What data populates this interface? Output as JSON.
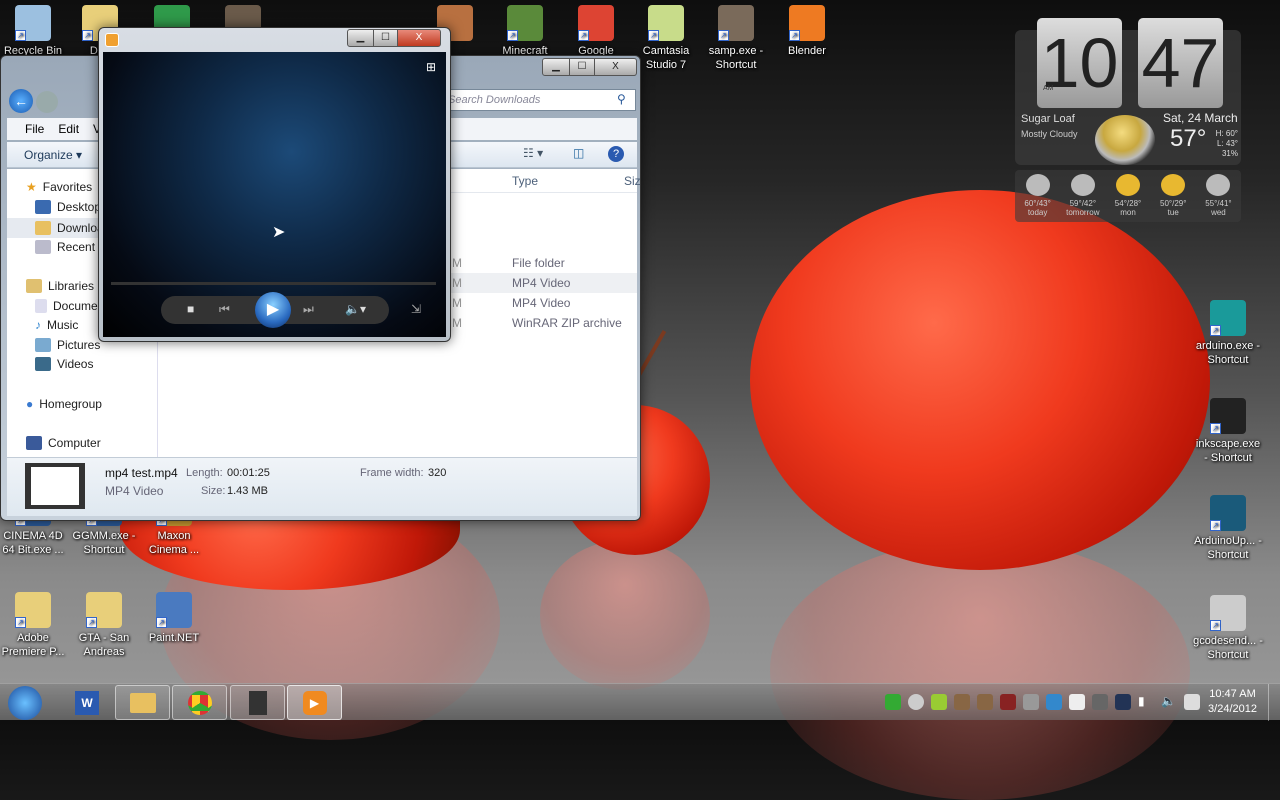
{
  "desktop_icons_top": [
    {
      "label": "Recycle Bin",
      "color": "#9cc0e0"
    },
    {
      "label": "Dr...",
      "color": "#e8cf7a"
    },
    {
      "label": "",
      "color": "#2f9a4a"
    },
    {
      "label": "",
      "color": "#6a5a4a"
    },
    {
      "label": "",
      "color": "#b87040"
    },
    {
      "label": "Minecraft",
      "color": "#5a8a3a"
    },
    {
      "label": "Google Chrome",
      "color": "#dd4433"
    },
    {
      "label": "Camtasia Studio 7",
      "color": "#c8dc8a"
    },
    {
      "label": "samp.exe - Shortcut",
      "color": "#7a6a5a"
    },
    {
      "label": "Blender",
      "color": "#ee7a22"
    }
  ],
  "desktop_icons_left": [
    {
      "label": "CINEMA 4D 64 Bit.exe ...",
      "color": "#2a5a9a"
    },
    {
      "label": "GGMM.exe - Shortcut",
      "color": "#2a5a9a"
    },
    {
      "label": "Maxon Cinema ...",
      "color": "#c89a30"
    },
    {
      "label": "Adobe Premiere P...",
      "color": "#e8cf7a"
    },
    {
      "label": "GTA - San Andreas",
      "color": "#e8cf7a"
    },
    {
      "label": "Paint.NET",
      "color": "#4a7ac0"
    }
  ],
  "desktop_icons_right": [
    {
      "label": "arduino.exe - Shortcut",
      "color": "#1a9a9a"
    },
    {
      "label": "inkscape.exe - Shortcut",
      "color": "#222222"
    },
    {
      "label": "ArduinoUp... - Shortcut",
      "color": "#1a5a7a"
    },
    {
      "label": "gcodesend... - Shortcut",
      "color": "#cccccc"
    }
  ],
  "widget": {
    "hour": "10",
    "minute": "47",
    "ampm": "AM",
    "location": "Sugar Loaf",
    "condition": "Mostly Cloudy",
    "date": "Sat, 24 March",
    "temp": "57°",
    "high": "H: 60°",
    "low": "L: 43°",
    "humidity": "31%",
    "forecast": [
      {
        "temps": "60°/43°",
        "day": "today"
      },
      {
        "temps": "59°/42°",
        "day": "tomorrow"
      },
      {
        "temps": "54°/28°",
        "day": "mon"
      },
      {
        "temps": "50°/29°",
        "day": "tue"
      },
      {
        "temps": "55°/41°",
        "day": "wed"
      }
    ]
  },
  "explorer": {
    "search_placeholder": "Search Downloads",
    "menu": [
      "File",
      "Edit",
      "V"
    ],
    "organize": "Organize ▾",
    "nav": {
      "favorites": "Favorites",
      "desktop": "Desktop",
      "downloads": "Downloads",
      "recent": "Recent Places",
      "libraries": "Libraries",
      "documents": "Documents",
      "music": "Music",
      "pictures": "Pictures",
      "videos": "Videos",
      "homegroup": "Homegroup",
      "computer": "Computer"
    },
    "columns": {
      "type": "Type",
      "size": "Siz"
    },
    "rows": [
      {
        "date_tail": "M",
        "type": "File folder"
      },
      {
        "date_tail": "M",
        "type": "MP4 Video"
      },
      {
        "date_tail": "M",
        "type": "MP4 Video"
      },
      {
        "date_tail": "M",
        "type": "WinRAR ZIP archive"
      }
    ],
    "details": {
      "name": "mp4 test.mp4",
      "kind": "MP4 Video",
      "length_label": "Length:",
      "length": "00:01:25",
      "size_label": "Size:",
      "size": "1.43 MB",
      "fw_label": "Frame width:",
      "fw": "320"
    }
  },
  "taskbar": {
    "time": "10:47 AM",
    "date": "3/24/2012"
  }
}
